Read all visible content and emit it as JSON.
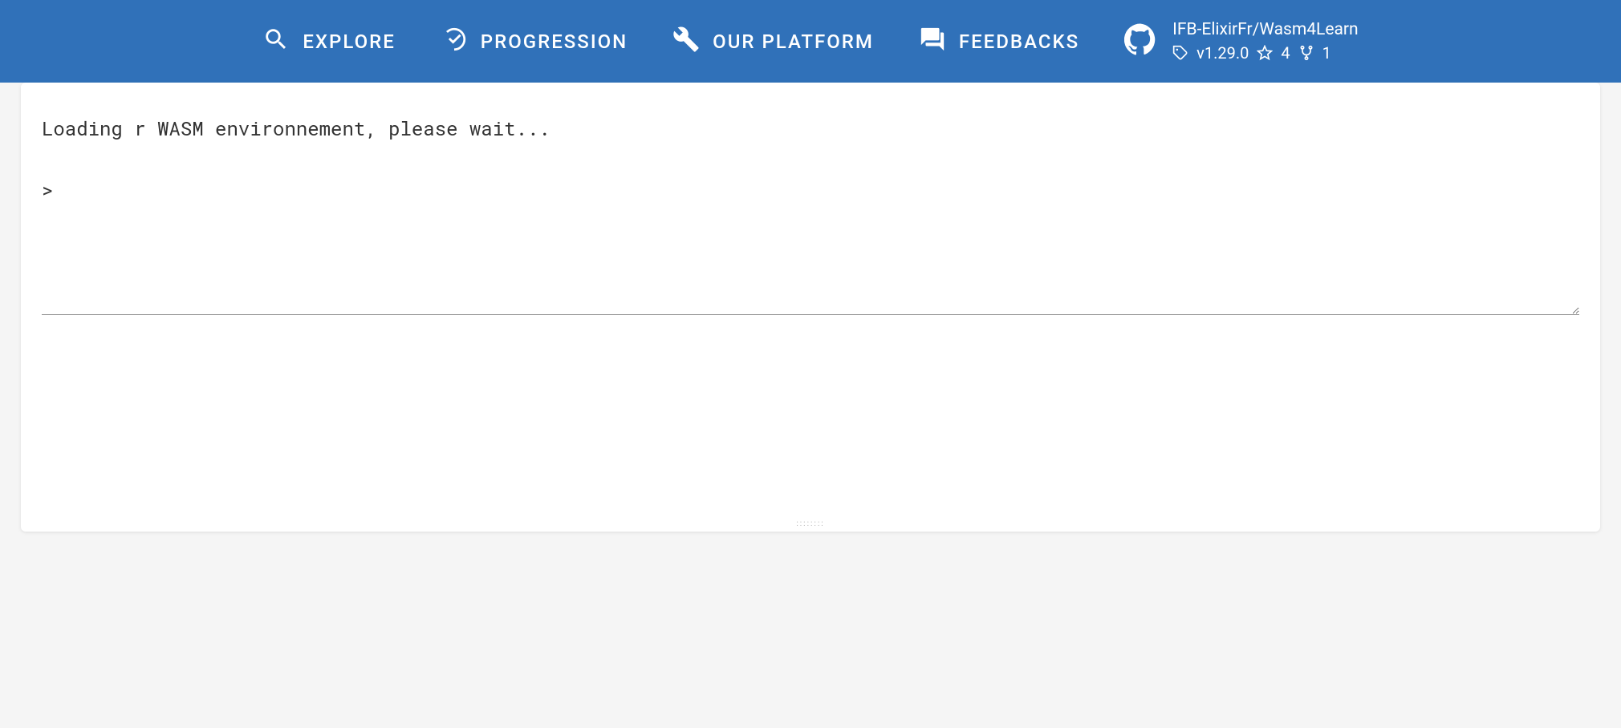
{
  "header": {
    "nav": [
      {
        "id": "explore",
        "label": "EXPLORE"
      },
      {
        "id": "progression",
        "label": "PROGRESSION"
      },
      {
        "id": "platform",
        "label": "OUR PLATFORM"
      },
      {
        "id": "feedbacks",
        "label": "FEEDBACKS"
      }
    ],
    "github": {
      "repo": "IFB-ElixirFr/Wasm4Learn",
      "version": "v1.29.0",
      "stars": "4",
      "forks": "1"
    }
  },
  "terminal": {
    "content": "Loading r WASM environnement, please wait...\n\n> "
  }
}
